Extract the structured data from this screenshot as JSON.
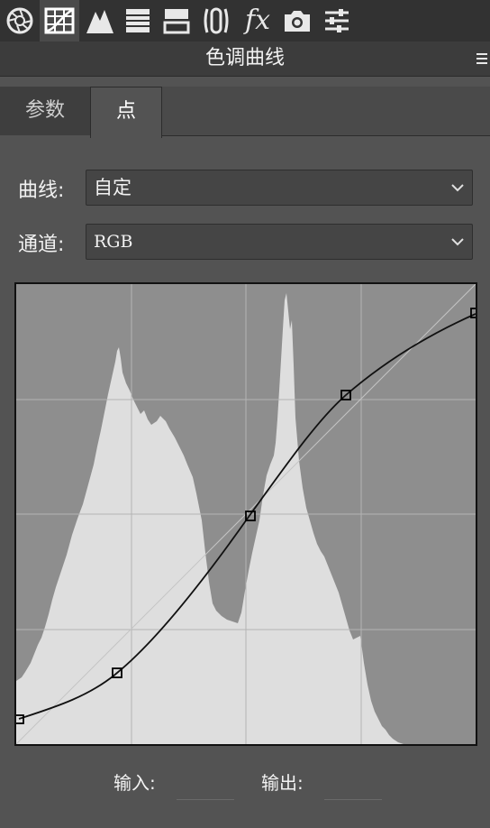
{
  "toolbar": {
    "tools": [
      {
        "icon": "aperture-icon"
      },
      {
        "icon": "tone-curve-grid-icon",
        "active": true
      },
      {
        "icon": "mountain-icon"
      },
      {
        "icon": "hsl-bars-icon"
      },
      {
        "icon": "split-toning-icon"
      },
      {
        "icon": "lens-correction-icon"
      },
      {
        "icon": "fx-icon",
        "text": "fx"
      },
      {
        "icon": "camera-icon"
      },
      {
        "icon": "sliders-icon"
      }
    ]
  },
  "panel": {
    "title": "色调曲线",
    "menu_icon": "panel-menu-icon"
  },
  "tabs": {
    "params": "参数",
    "point": "点"
  },
  "curve": {
    "label": "曲线:",
    "value": "自定"
  },
  "channel": {
    "label": "通道:",
    "value": "RGB"
  },
  "io": {
    "input_label": "输入:",
    "input_value": "",
    "output_label": "输出:",
    "output_value": ""
  },
  "curve_points": [
    {
      "input": 0,
      "output": 24
    },
    {
      "input": 56,
      "output": 41
    },
    {
      "input": 129,
      "output": 127
    },
    {
      "input": 183,
      "output": 195
    },
    {
      "input": 255,
      "output": 239
    }
  ],
  "colors": {
    "histogram": "#dedede",
    "graph_bg": "#8e8e8e",
    "curve": "#111111"
  }
}
